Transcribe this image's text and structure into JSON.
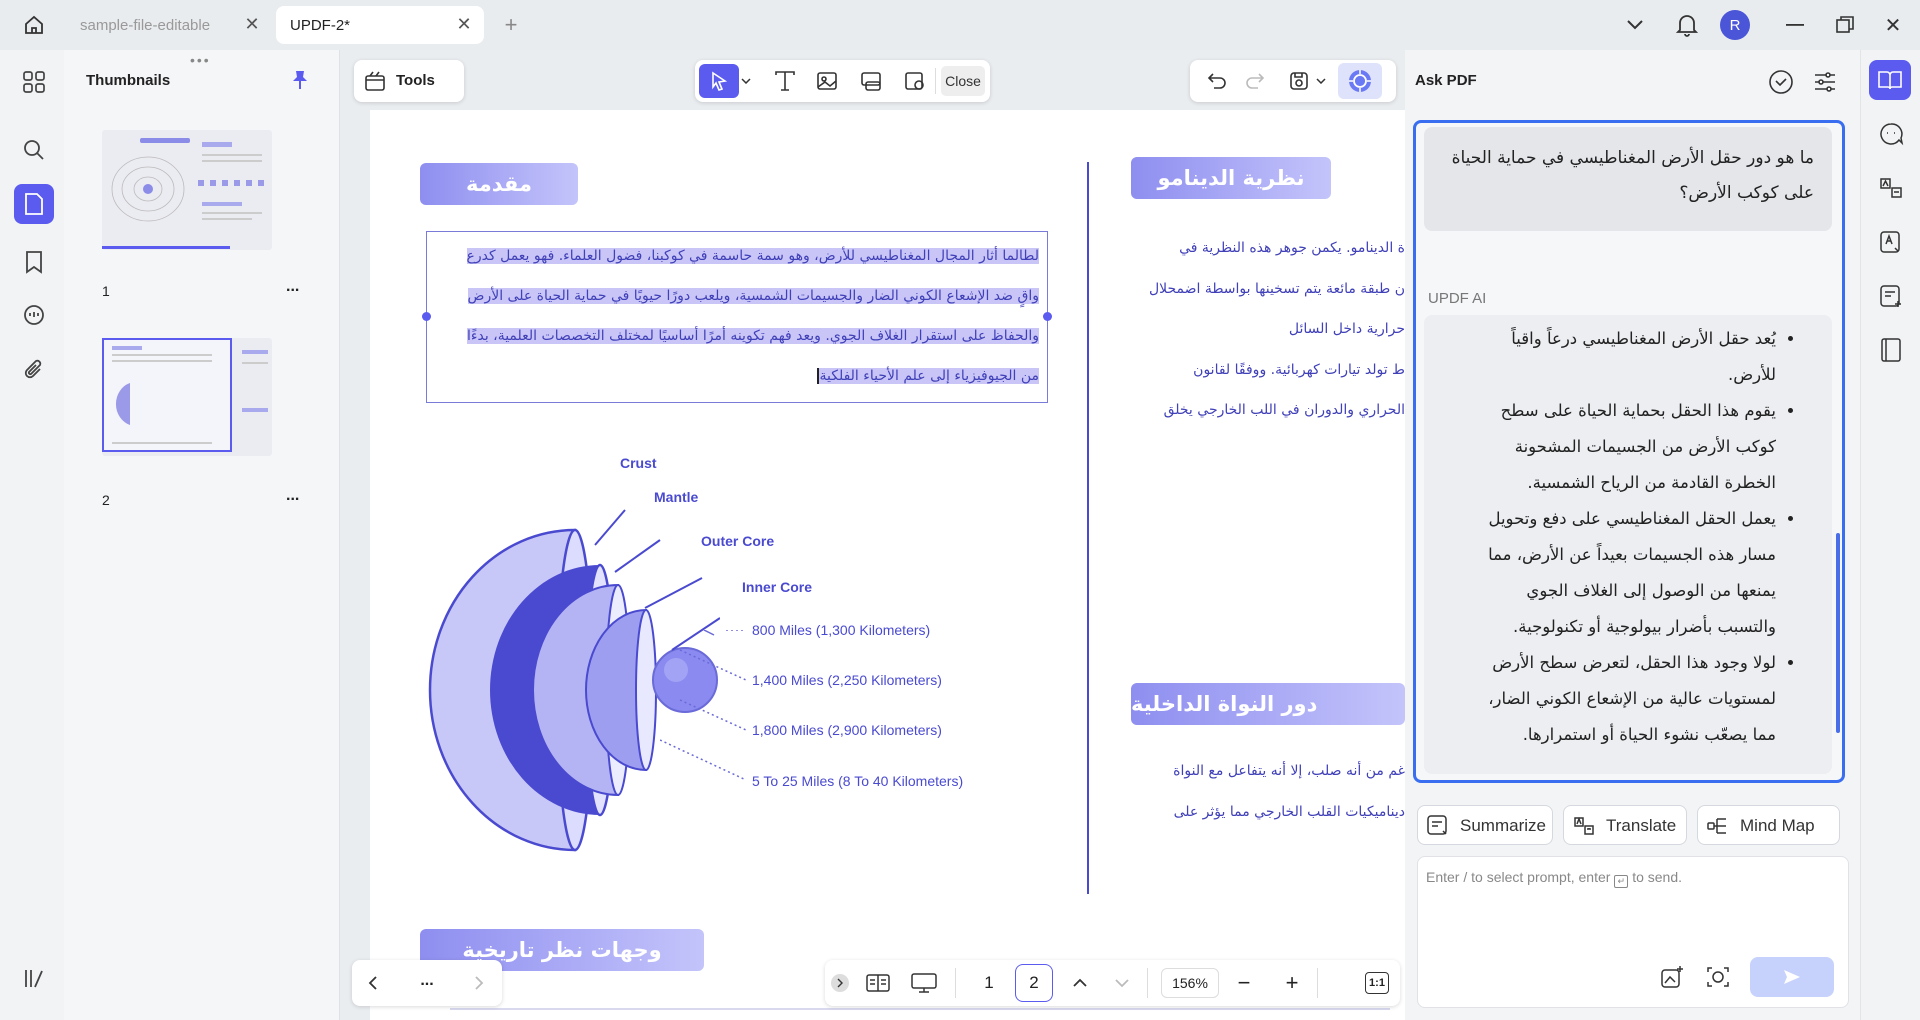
{
  "tabs": [
    {
      "label": "sample-file-editable",
      "active": false
    },
    {
      "label": "UPDF-2*",
      "active": true
    }
  ],
  "user_initial": "R",
  "thumbnails": {
    "title": "Thumbnails",
    "pages": [
      {
        "number": "1",
        "more": "..."
      },
      {
        "number": "2",
        "more": "..."
      }
    ]
  },
  "toolbar": {
    "tools_label": "Tools",
    "close_label": "Close"
  },
  "document": {
    "intro_title": "مقدمة",
    "intro_lines": [
      "لطالما أثار المجال المغناطيسي للأرض، وهو سمة حاسمة في كوكبنا، فضول العلماء. فهو يعمل كدرع",
      "واقٍ ضد الإشعاع الكوني الضار والجسيمات الشمسية، ويلعب دورًا حيويًا في حماية الحياة على الأرض",
      "والحفاظ على استقرار الغلاف الجوي. ويعد فهم تكوينه أمرًا أساسيًا لمختلف التخصصات العلمية، بدءًا",
      "من الجيوفيزياء إلى علم الأحياء الفلكية"
    ],
    "dynamo_title": "نظرية الدينامو",
    "dynamo_lines": [
      "ة الدينامو. يكمن جوهر هذه النظرية في",
      "ن طبقة مائعة يتم تسخينها بواسطة اضمحلال",
      "حرارية داخل السائل",
      "ط تولد تيارات كهربائية. ووفقًا لقانون",
      "الحراري والدوران في اللب الخارجي يخلق"
    ],
    "core_title": "دور النواة الداخلية",
    "core_lines": [
      "غم من أنه صلب، إلا أنه يتفاعل مع النواة",
      "ديناميكيات القلب الخارجي مما يؤثر على"
    ],
    "history_title": "وجهات نظر تاريخية",
    "diagram": {
      "layers": [
        "Crust",
        "Mantle",
        "Outer Core",
        "Inner Core"
      ],
      "distances": [
        "800 Miles (1,300 Kilometers)",
        "1,400 Miles (2,250 Kilometers)",
        "1,800 Miles (2,900 Kilometers)",
        "5 To 25 Miles (8 To 40 Kilometers)"
      ]
    }
  },
  "bottom_bar": {
    "page_current": "1",
    "page_total": "2",
    "zoom": "156%",
    "more": "...",
    "ratio": "1:1"
  },
  "ask_pdf": {
    "title": "Ask PDF",
    "question": "ما هو دور حقل الأرض المغناطيسي في حماية الحياة على كوكب الأرض؟",
    "ai_label": "UPDF AI",
    "answer_bullets": [
      "يُعد حقل الأرض المغناطيسي درعاً واقياً للأرض.",
      "يقوم هذا الحقل بحماية الحياة على سطح كوكب الأرض من الجسيمات المشحونة الخطرة القادمة من الرياح الشمسية.",
      "يعمل الحقل المغناطيسي على دفع وتحويل مسار هذه الجسيمات بعيداً عن الأرض، مما يمنعها من الوصول إلى الغلاف الجوي والتسبب بأضرار بيولوجية أو تكنولوجية.",
      "لولا وجود هذا الحقل، لتعرض سطح الأرض لمستويات عالية من الإشعاع الكوني الضار، مما يصعّب نشوء الحياة أو استمرارها."
    ],
    "actions": {
      "summarize": "Summarize",
      "translate": "Translate",
      "mindmap": "Mind Map"
    },
    "prompt_placeholder": "Enter / to select prompt, enter",
    "prompt_placeholder_tail": "to send."
  },
  "colors": {
    "accent": "#5b5bf0",
    "selection": "#c9c6f7",
    "header_grad": "#8e8ef0"
  }
}
